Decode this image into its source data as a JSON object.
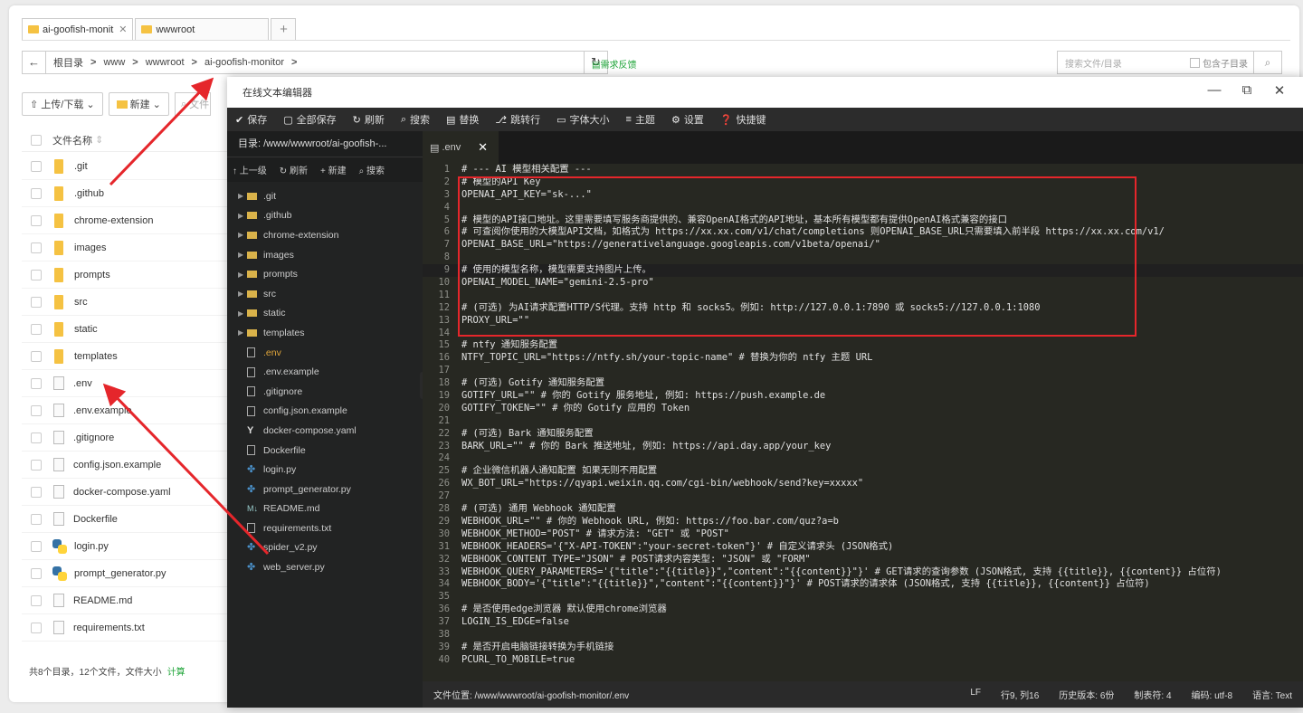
{
  "file_manager": {
    "tabs": [
      {
        "label": "ai-goofish-monit"
      },
      {
        "label": "wwwroot"
      }
    ],
    "path": [
      "根目录",
      "www",
      "wwwroot",
      "ai-goofish-monitor"
    ],
    "feedback": "需求反馈",
    "search_placeholder": "搜索文件/目录",
    "include_subdir": "包含子目录",
    "upload_label": "上传/下载",
    "new_label": "新建",
    "file_search_placeholder": "文件",
    "column_name": "文件名称",
    "files": [
      {
        "name": ".git",
        "type": "folder"
      },
      {
        "name": ".github",
        "type": "folder"
      },
      {
        "name": "chrome-extension",
        "type": "folder"
      },
      {
        "name": "images",
        "type": "folder"
      },
      {
        "name": "prompts",
        "type": "folder"
      },
      {
        "name": "src",
        "type": "folder"
      },
      {
        "name": "static",
        "type": "folder"
      },
      {
        "name": "templates",
        "type": "folder"
      },
      {
        "name": ".env",
        "type": "file"
      },
      {
        "name": ".env.example",
        "type": "file"
      },
      {
        "name": ".gitignore",
        "type": "file"
      },
      {
        "name": "config.json.example",
        "type": "file"
      },
      {
        "name": "docker-compose.yaml",
        "type": "file"
      },
      {
        "name": "Dockerfile",
        "type": "file"
      },
      {
        "name": "login.py",
        "type": "py"
      },
      {
        "name": "prompt_generator.py",
        "type": "py"
      },
      {
        "name": "README.md",
        "type": "file"
      },
      {
        "name": "requirements.txt",
        "type": "file"
      }
    ],
    "footer": "共8个目录，12个文件，文件大小",
    "footer_calc": "计算"
  },
  "editor": {
    "title": "在线文本编辑器",
    "menu": [
      {
        "icon": "✔",
        "label": "保存"
      },
      {
        "icon": "▢",
        "label": "全部保存"
      },
      {
        "icon": "↻",
        "label": "刷新"
      },
      {
        "icon": "⌕",
        "label": "搜索"
      },
      {
        "icon": "▤",
        "label": "替换"
      },
      {
        "icon": "⎇",
        "label": "跳转行"
      },
      {
        "icon": "▭",
        "label": "字体大小"
      },
      {
        "icon": "≡",
        "label": "主题"
      },
      {
        "icon": "⚙",
        "label": "设置"
      },
      {
        "icon": "❓",
        "label": "快捷键"
      }
    ],
    "dir": "目录: /www/wwwroot/ai-goofish-...",
    "sidebar_actions": [
      "↑ 上一级",
      "↻ 刷新",
      "+ 新建",
      "⌕ 搜索"
    ],
    "tree": [
      {
        "name": ".git",
        "type": "folder"
      },
      {
        "name": ".github",
        "type": "folder"
      },
      {
        "name": "chrome-extension",
        "type": "folder"
      },
      {
        "name": "images",
        "type": "folder"
      },
      {
        "name": "prompts",
        "type": "folder"
      },
      {
        "name": "src",
        "type": "folder"
      },
      {
        "name": "static",
        "type": "folder"
      },
      {
        "name": "templates",
        "type": "folder"
      },
      {
        "name": ".env",
        "type": "file",
        "active": true
      },
      {
        "name": ".env.example",
        "type": "file"
      },
      {
        "name": ".gitignore",
        "type": "file"
      },
      {
        "name": "config.json.example",
        "type": "file"
      },
      {
        "name": "docker-compose.yaml",
        "type": "yaml"
      },
      {
        "name": "Dockerfile",
        "type": "file"
      },
      {
        "name": "login.py",
        "type": "py"
      },
      {
        "name": "prompt_generator.py",
        "type": "py"
      },
      {
        "name": "README.md",
        "type": "md"
      },
      {
        "name": "requirements.txt",
        "type": "file"
      },
      {
        "name": "spider_v2.py",
        "type": "py"
      },
      {
        "name": "web_server.py",
        "type": "py"
      }
    ],
    "tab": ".env",
    "code_lines": [
      "# --- AI 模型相关配置 ---",
      "# 模型的API Key",
      "OPENAI_API_KEY=\"sk-...\"",
      "",
      "# 模型的API接口地址。这里需要填写服务商提供的、兼容OpenAI格式的API地址，基本所有模型都有提供OpenAI格式兼容的接口",
      "# 可查阅你使用的大模型API文档，如格式为 https://xx.xx.com/v1/chat/completions 则OPENAI_BASE_URL只需要填入前半段 https://xx.xx.com/v1/",
      "OPENAI_BASE_URL=\"https://generativelanguage.googleapis.com/v1beta/openai/\"",
      "",
      "# 使用的模型名称，模型需要支持图片上传。",
      "OPENAI_MODEL_NAME=\"gemini-2.5-pro\"",
      "",
      "# (可选) 为AI请求配置HTTP/S代理。支持 http 和 socks5。例如: http://127.0.0.1:7890 或 socks5://127.0.0.1:1080",
      "PROXY_URL=\"\"",
      "",
      "# ntfy 通知服务配置",
      "NTFY_TOPIC_URL=\"https://ntfy.sh/your-topic-name\" # 替换为你的 ntfy 主题 URL",
      "",
      "# (可选) Gotify 通知服务配置",
      "GOTIFY_URL=\"\" # 你的 Gotify 服务地址, 例如: https://push.example.de",
      "GOTIFY_TOKEN=\"\" # 你的 Gotify 应用的 Token",
      "",
      "# (可选) Bark 通知服务配置",
      "BARK_URL=\"\" # 你的 Bark 推送地址, 例如: https://api.day.app/your_key",
      "",
      "# 企业微信机器人通知配置 如果无则不用配置",
      "WX_BOT_URL=\"https://qyapi.weixin.qq.com/cgi-bin/webhook/send?key=xxxxx\"",
      "",
      "# (可选) 通用 Webhook 通知配置",
      "WEBHOOK_URL=\"\" # 你的 Webhook URL, 例如: https://foo.bar.com/quz?a=b",
      "WEBHOOK_METHOD=\"POST\" # 请求方法: \"GET\" 或 \"POST\"",
      "WEBHOOK_HEADERS='{\"X-API-TOKEN\":\"your-secret-token\"}' # 自定义请求头 (JSON格式)",
      "WEBHOOK_CONTENT_TYPE=\"JSON\" # POST请求内容类型: \"JSON\" 或 \"FORM\"",
      "WEBHOOK_QUERY_PARAMETERS='{\"title\":\"{{title}}\",\"content\":\"{{content}}\"}' # GET请求的查询参数 (JSON格式, 支持 {{title}}, {{content}} 占位符)",
      "WEBHOOK_BODY='{\"title\":\"{{title}}\",\"content\":\"{{content}}\"}' # POST请求的请求体 (JSON格式, 支持 {{title}}, {{content}} 占位符)",
      "",
      "# 是否使用edge浏览器 默认使用chrome浏览器",
      "LOGIN_IS_EDGE=false",
      "",
      "# 是否开启电脑链接转换为手机链接",
      "PCURL_TO_MOBILE=true"
    ],
    "status": {
      "path": "文件位置: /www/wwwroot/ai-goofish-monitor/.env",
      "eol": "LF",
      "position": "行9, 列16",
      "history": "历史版本: 6份",
      "tab": "制表符: 4",
      "encoding": "编码: utf-8",
      "language": "语言: Text"
    }
  },
  "colors": {
    "annotation_red": "#e5262b",
    "accent_green": "#20a53a",
    "editor_bg": "#272822"
  }
}
